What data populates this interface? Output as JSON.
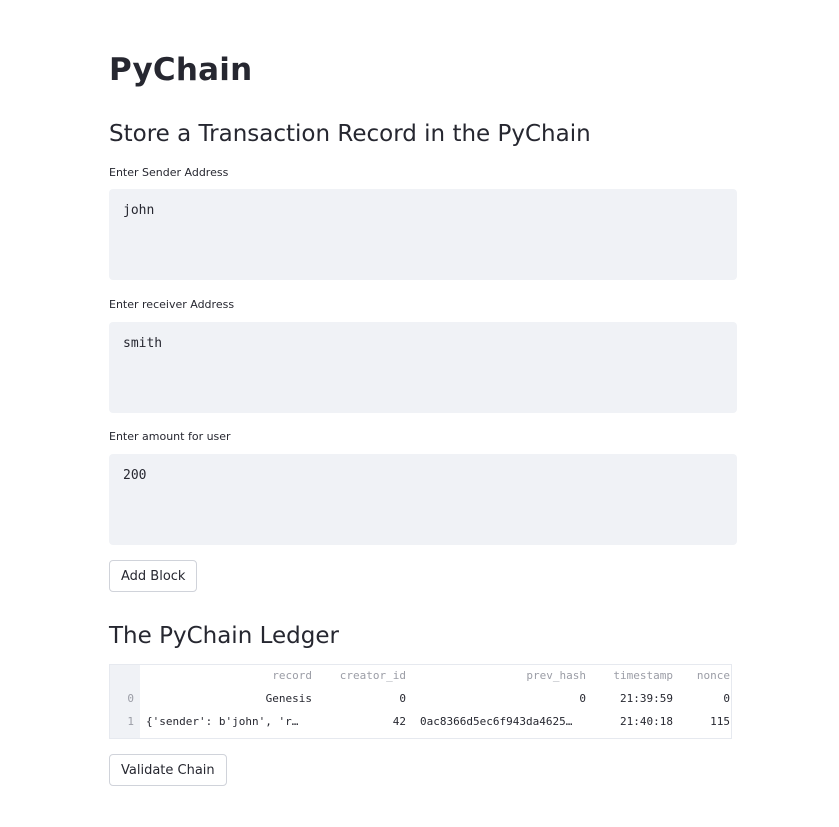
{
  "page": {
    "title": "PyChain"
  },
  "form": {
    "section_title": "Store a Transaction Record in the PyChain",
    "sender": {
      "label": "Enter Sender Address",
      "value": "john"
    },
    "receiver": {
      "label": "Enter receiver Address",
      "value": "smith"
    },
    "amount": {
      "label": "Enter amount for user",
      "value": "200"
    },
    "add_block_label": "Add Block"
  },
  "ledger": {
    "section_title": "The PyChain Ledger",
    "columns": [
      "record",
      "creator_id",
      "prev_hash",
      "timestamp",
      "nonce"
    ],
    "rows": [
      {
        "index": "0",
        "record": "Genesis",
        "creator_id": "0",
        "prev_hash": "0",
        "timestamp": "21:39:59",
        "nonce": "0"
      },
      {
        "index": "1",
        "record": "{'sender': b'john', 'r…",
        "creator_id": "42",
        "prev_hash": "0ac8366d5ec6f943da4625…",
        "timestamp": "21:40:18",
        "nonce": "115"
      }
    ],
    "validate_label": "Validate Chain"
  }
}
